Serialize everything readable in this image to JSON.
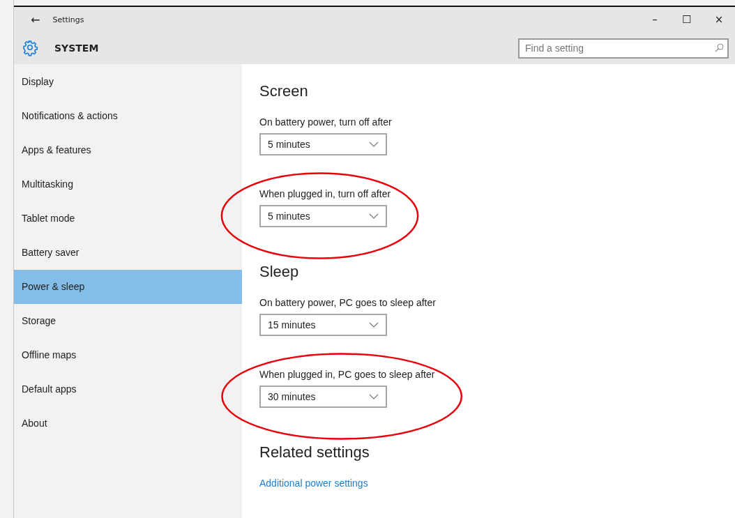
{
  "window": {
    "title": "Settings",
    "back": "←",
    "controls": [
      "–",
      "☐",
      "×"
    ]
  },
  "header": {
    "title": "SYSTEM"
  },
  "search": {
    "placeholder": "Find a setting"
  },
  "sidebar": {
    "items": [
      {
        "label": "Display",
        "selected": false
      },
      {
        "label": "Notifications & actions",
        "selected": false
      },
      {
        "label": "Apps & features",
        "selected": false
      },
      {
        "label": "Multitasking",
        "selected": false
      },
      {
        "label": "Tablet mode",
        "selected": false
      },
      {
        "label": "Battery saver",
        "selected": false
      },
      {
        "label": "Power & sleep",
        "selected": true
      },
      {
        "label": "Storage",
        "selected": false
      },
      {
        "label": "Offline maps",
        "selected": false
      },
      {
        "label": "Default apps",
        "selected": false
      },
      {
        "label": "About",
        "selected": false
      }
    ]
  },
  "sections": [
    {
      "heading": "Screen",
      "settings": [
        {
          "label": "On battery power, turn off after",
          "value": "5 minutes",
          "circled": false
        },
        {
          "label": "When plugged in, turn off after",
          "value": "5 minutes",
          "circled": true
        }
      ]
    },
    {
      "heading": "Sleep",
      "settings": [
        {
          "label": "On battery power, PC goes to sleep after",
          "value": "15 minutes",
          "circled": false
        },
        {
          "label": "When plugged in, PC goes to sleep after",
          "value": "30 minutes",
          "circled": true
        }
      ]
    }
  ],
  "related": {
    "heading": "Related settings",
    "link": "Additional power settings"
  }
}
